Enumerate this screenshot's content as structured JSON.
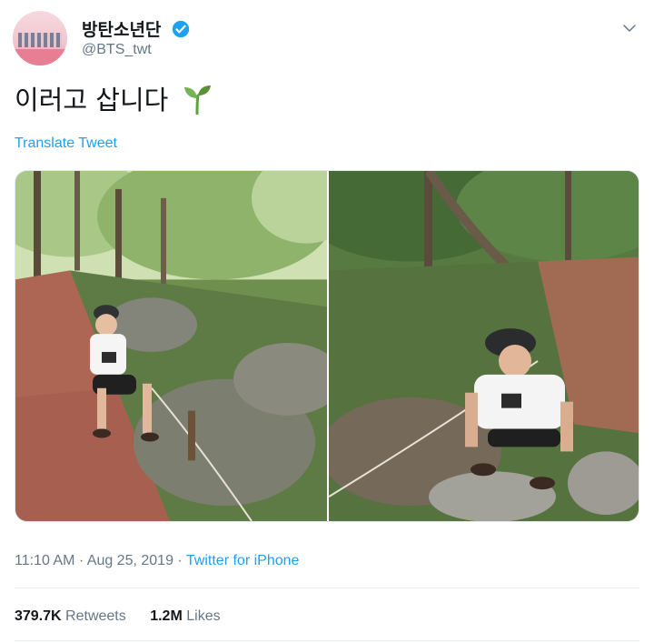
{
  "account": {
    "display_name": "방탄소년단",
    "handle": "@BTS_twt",
    "verified": true
  },
  "tweet": {
    "text": "이러고 삽니다",
    "emoji": "seedling-emoji",
    "translate_label": "Translate Tweet",
    "time": "11:10 AM",
    "separator": "·",
    "date": "Aug 25, 2019",
    "source": "Twitter for iPhone"
  },
  "media": {
    "photos": [
      "photo-forest-path-left",
      "photo-forest-path-right"
    ]
  },
  "stats": {
    "retweets_count": "379.7K",
    "retweets_label": "Retweets",
    "likes_count": "1.2M",
    "likes_label": "Likes"
  },
  "colors": {
    "link": "#1da1f2",
    "secondary_text": "#657786",
    "primary_text": "#14171a",
    "verified": "#1da1f2"
  },
  "icons": {
    "verified": "verified-badge-icon",
    "menu": "chevron-down-icon"
  }
}
